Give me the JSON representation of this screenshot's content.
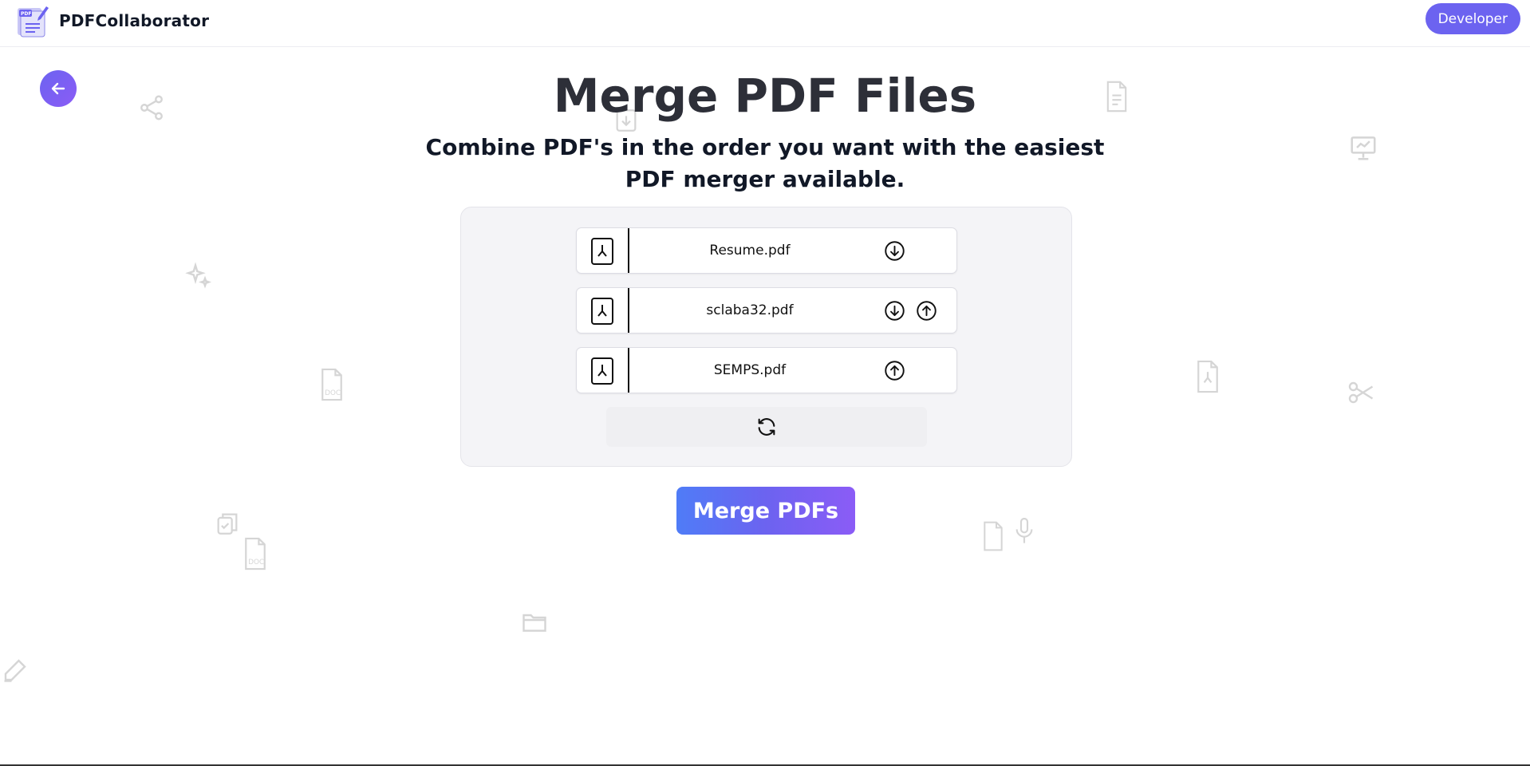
{
  "app": {
    "name": "PDFCollaborator",
    "logo_icon": "pdf-logo-icon",
    "developer_label": "Developer"
  },
  "nav": {
    "back_icon": "arrow-left-icon"
  },
  "main": {
    "title": "Merge PDF Files",
    "subtitle": "Combine PDF's in the order you want with the easiest PDF merger available."
  },
  "files": [
    {
      "name": "Resume.pdf",
      "icon": "pdf-file-icon",
      "actions": [
        "move-down"
      ]
    },
    {
      "name": "sclaba32.pdf",
      "icon": "pdf-file-icon",
      "actions": [
        "move-down",
        "move-up"
      ]
    },
    {
      "name": "SEMPS.pdf",
      "icon": "pdf-file-icon",
      "actions": [
        "move-up"
      ]
    }
  ],
  "controls": {
    "refresh_icon": "refresh-icon",
    "merge_label": "Merge PDFs"
  },
  "colors": {
    "accent": "#6c63f0",
    "gradient_start": "#4f7cf7",
    "gradient_end": "#8b5cf6",
    "card_bg": "#f4f4f7",
    "title_text": "#2d2f38"
  }
}
